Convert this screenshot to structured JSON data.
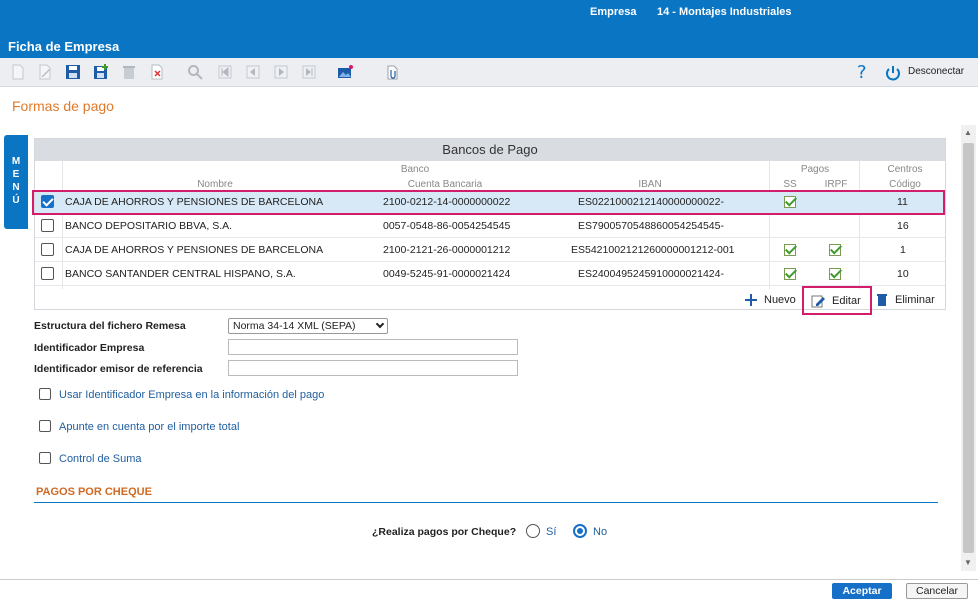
{
  "header": {
    "empresa_label": "Empresa",
    "empresa_value": "14 - Montajes Industriales",
    "window_title": "Ficha de Empresa"
  },
  "toolbar": {
    "help_label": "?",
    "disconnect_label": "Desconectar"
  },
  "section_title": "Formas de pago",
  "menu_tab": "MENÚ",
  "grid": {
    "title": "Bancos de Pago",
    "group_headers": {
      "banco": "Banco",
      "pagos": "Pagos",
      "centros": "Centros"
    },
    "columns": {
      "nombre": "Nombre",
      "cuenta": "Cuenta Bancaria",
      "iban": "IBAN",
      "ss": "SS",
      "irpf": "IRPF",
      "codigo": "Código"
    },
    "rows": [
      {
        "checked": true,
        "nombre": "CAJA DE AHORROS Y PENSIONES DE BARCELONA",
        "cuenta": "2100-0212-14-0000000022",
        "iban": "ES0221000212140000000022-",
        "ss": true,
        "irpf": false,
        "codigo": "11"
      },
      {
        "checked": false,
        "nombre": "BANCO DEPOSITARIO BBVA, S.A.",
        "cuenta": "0057-0548-86-0054254545",
        "iban": "ES7900570548860054254545-",
        "ss": false,
        "irpf": false,
        "codigo": "16"
      },
      {
        "checked": false,
        "nombre": "CAJA DE AHORROS Y PENSIONES DE BARCELONA",
        "cuenta": "2100-2121-26-0000001212",
        "iban": "ES5421002121260000001212-001",
        "ss": true,
        "irpf": true,
        "codigo": "1"
      },
      {
        "checked": false,
        "nombre": "BANCO SANTANDER CENTRAL HISPANO, S.A.",
        "cuenta": "0049-5245-91-0000021424",
        "iban": "ES2400495245910000021424-",
        "ss": true,
        "irpf": true,
        "codigo": "10"
      }
    ],
    "actions": {
      "nuevo": "Nuevo",
      "editar": "Editar",
      "eliminar": "Eliminar"
    }
  },
  "form": {
    "estructura_label": "Estructura del fichero Remesa",
    "estructura_value": "Norma 34-14 XML (SEPA)",
    "identificador_label": "Identificador Empresa",
    "identificador_value": "",
    "emisor_label": "Identificador emisor de referencia",
    "emisor_value": "",
    "opt_identificador": "Usar Identificador Empresa en la información del pago",
    "opt_apunte": "Apunte en cuenta por el importe total",
    "opt_control": "Control de Suma"
  },
  "cheque": {
    "section": "PAGOS POR CHEQUE",
    "question": "¿Realiza pagos por Cheque?",
    "si": "Sí",
    "no": "No",
    "selected": "No"
  },
  "footer": {
    "aceptar": "Aceptar",
    "cancelar": "Cancelar"
  },
  "colors": {
    "brand": "#0a75c2",
    "accent": "#e07a2a",
    "highlight": "#d31c6b",
    "selected_row": "#d7e8f6"
  }
}
